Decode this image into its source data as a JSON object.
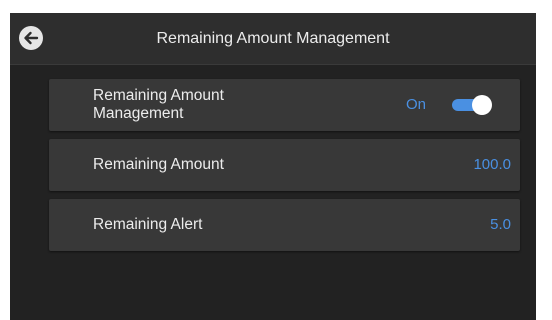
{
  "header": {
    "title": "Remaining Amount Management",
    "back_icon": "arrow-left-icon"
  },
  "settings": [
    {
      "label": "Remaining Amount Management",
      "state": "On",
      "toggle_on": true
    },
    {
      "label": "Remaining Amount",
      "value": "100.0"
    },
    {
      "label": "Remaining Alert",
      "value": "5.0"
    }
  ],
  "colors": {
    "accent": "#4a90e2",
    "background": "#222222",
    "row_background": "#383838",
    "text": "#ececec"
  }
}
